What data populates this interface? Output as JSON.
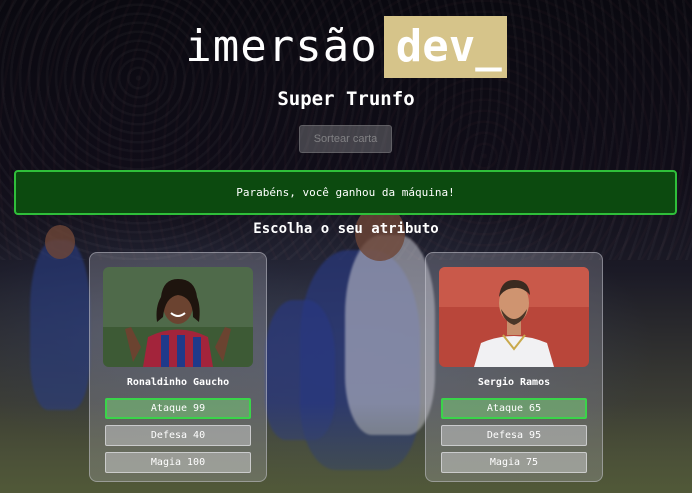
{
  "header": {
    "logo_text": "imersão",
    "logo_badge": "dev_",
    "title": "Super Trunfo"
  },
  "controls": {
    "draw_button_label": "Sortear carta"
  },
  "result": {
    "message": "Parabéns, você ganhou da máquina!"
  },
  "prompt": {
    "choose_attribute": "Escolha o seu atributo"
  },
  "player_card": {
    "name": "Ronaldinho Gaucho",
    "attributes": [
      {
        "label": "Ataque 99",
        "selected": true
      },
      {
        "label": "Defesa 40",
        "selected": false
      },
      {
        "label": "Magia 100",
        "selected": false
      }
    ]
  },
  "machine_card": {
    "name": "Sergio Ramos",
    "attributes": [
      {
        "label": "Ataque 65",
        "selected": true
      },
      {
        "label": "Defesa 95",
        "selected": false
      },
      {
        "label": "Magia 75",
        "selected": false
      }
    ]
  },
  "colors": {
    "badge": "#d6c48a",
    "result_bg": "#0c4a0f",
    "result_border": "#2fbf3a",
    "selected_border": "#3ad44a"
  }
}
